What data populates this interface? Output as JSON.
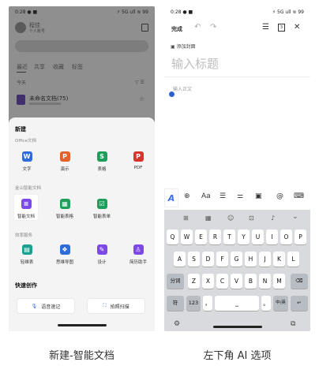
{
  "left": {
    "status_time": "0:28 ● ■",
    "status_icons": "⚡ 5G ull ≋ 99",
    "user_name": "程佳",
    "user_sub": "个人账号",
    "tabs": [
      "最近",
      "共享",
      "收藏",
      "标签"
    ],
    "section_today": "今天",
    "recent_doc": "未命名文档(75)",
    "new_title": "新建",
    "office_label": "Office文档",
    "office_items": [
      {
        "label": "文字",
        "icon": "W",
        "color": "#2f6bd9"
      },
      {
        "label": "演示",
        "icon": "P",
        "color": "#e2622a"
      },
      {
        "label": "表格",
        "icon": "S",
        "color": "#1f9e5a"
      },
      {
        "label": "PDF",
        "icon": "P",
        "color": "#d9342b"
      }
    ],
    "smart_label": "金山智能文档",
    "smart_items": [
      {
        "label": "智能文档",
        "icon": "≡",
        "color": "#7c48e8"
      },
      {
        "label": "智能表格",
        "icon": "▦",
        "color": "#1f9e5a"
      },
      {
        "label": "智能表单",
        "icon": "☑",
        "color": "#1f9e5a"
      }
    ],
    "service_label": "效率服务",
    "service_items": [
      {
        "label": "轻维表",
        "icon": "▤",
        "color": "#19a08e"
      },
      {
        "label": "思维导图",
        "icon": "❖",
        "color": "#2f6bd9"
      },
      {
        "label": "设计",
        "icon": "✎",
        "color": "#7c48e8"
      },
      {
        "label": "简历助手",
        "icon": "♙",
        "color": "#7c48e8"
      }
    ],
    "quick_title": "快速创作",
    "quick_buttons": [
      {
        "label": "语音速记",
        "icon": "🎙"
      },
      {
        "label": "拍照扫描",
        "icon": "⛶"
      }
    ]
  },
  "right": {
    "status_time": "0:28 ● ■",
    "status_icons": "⚡ 5G ull ≋ 99",
    "done": "完成",
    "cover": "添加封面",
    "title_placeholder": "输入标题",
    "body_placeholder": "输入正文",
    "format_icons": [
      "⊕",
      "Aa",
      "☰",
      "⚌",
      "▣",
      "@",
      "⌨"
    ],
    "kb_tools": [
      "⊞",
      "▦",
      "☺",
      "⊡",
      "♪",
      "⌄"
    ],
    "row1": [
      "Q",
      "W",
      "E",
      "R",
      "T",
      "Y",
      "U",
      "I",
      "O",
      "P"
    ],
    "row2": [
      "A",
      "S",
      "D",
      "F",
      "G",
      "H",
      "J",
      "K",
      "L"
    ],
    "row3": [
      "Z",
      "X",
      "C",
      "V",
      "B",
      "N",
      "M"
    ],
    "shift": "分词",
    "symbols": "符",
    "num": "123",
    "comma": "，",
    "period": "。",
    "lang": "中/英",
    "enter": "↵",
    "backspace": "⌫"
  },
  "captions": {
    "left": "新建-智能文档",
    "right": "左下角 AI 选项"
  }
}
